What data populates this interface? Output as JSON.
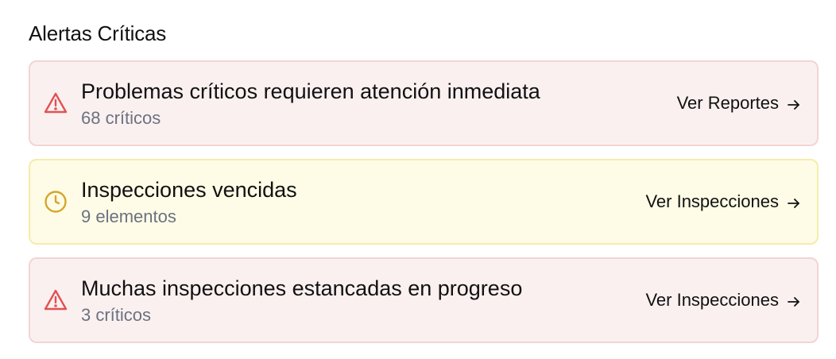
{
  "section": {
    "title": "Alertas Críticas"
  },
  "alerts": [
    {
      "severity": "critical",
      "icon": "warning-triangle-icon",
      "title": "Problemas críticos requieren atención inmediata",
      "subtitle": "68 críticos",
      "action": "Ver Reportes"
    },
    {
      "severity": "warning",
      "icon": "clock-icon",
      "title": "Inspecciones vencidas",
      "subtitle": "9 elementos",
      "action": "Ver Inspecciones"
    },
    {
      "severity": "critical",
      "icon": "warning-triangle-icon",
      "title": "Muchas inspecciones estancadas en progreso",
      "subtitle": "3 críticos",
      "action": "Ver Inspecciones"
    }
  ],
  "colors": {
    "critical_bg": "#fbf0f0",
    "critical_border": "#f3d4d4",
    "critical_icon": "#e05252",
    "warning_bg": "#fefce6",
    "warning_border": "#f5ecab",
    "warning_icon": "#d4a72c",
    "subtitle_text": "#6b7280"
  }
}
